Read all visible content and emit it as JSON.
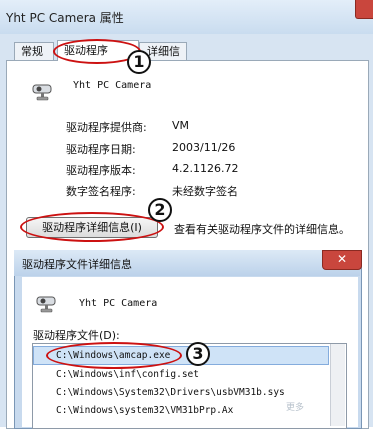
{
  "window": {
    "title": "Yht PC Camera 属性",
    "tabs": [
      "常规",
      "驱动程序",
      "详细信息"
    ],
    "device_name": "Yht PC Camera",
    "props": [
      {
        "label": "驱动程序提供商:",
        "value": "VM"
      },
      {
        "label": "驱动程序日期:",
        "value": "2003/11/26"
      },
      {
        "label": "驱动程序版本:",
        "value": "4.2.1126.72"
      },
      {
        "label": "数字签名程序:",
        "value": "未经数字签名"
      }
    ],
    "details_button": "驱动程序详细信息(I)",
    "details_desc": "查看有关驱动程序文件的详细信息。"
  },
  "dialog": {
    "title": "驱动程序文件详细信息",
    "close": "✕",
    "device_name": "Yht PC Camera",
    "files_label": "驱动程序文件(D):",
    "files": [
      "C:\\Windows\\amcap.exe",
      "C:\\Windows\\inf\\config.set",
      "C:\\Windows\\System32\\Drivers\\usbVM31b.sys",
      "C:\\Windows\\system32\\VM31bPrp.Ax"
    ]
  },
  "callouts": [
    "1",
    "2",
    "3"
  ],
  "watermark": "更多",
  "colors": {
    "callout_ring": "#cc1111",
    "selection": "#cfe3f7",
    "window_frame": "#c8daee"
  }
}
